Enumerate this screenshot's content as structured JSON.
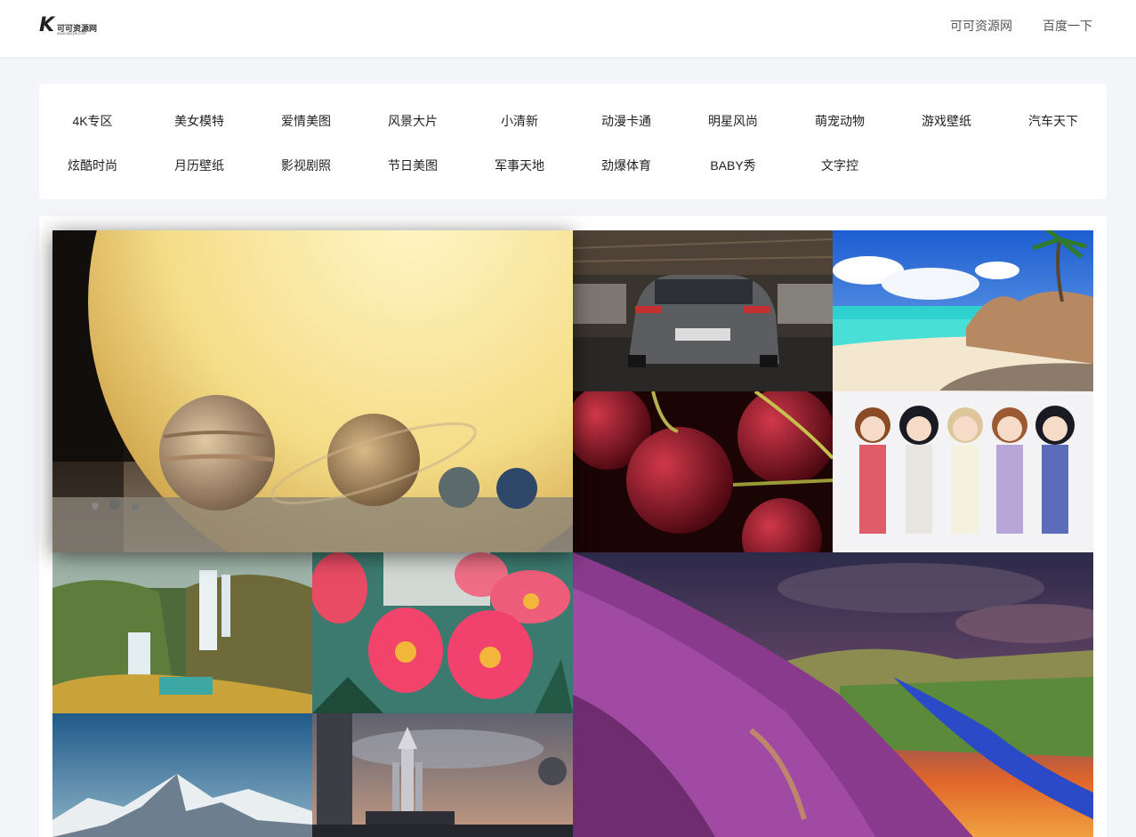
{
  "header": {
    "logo_letter": "K",
    "logo_text": "可可资源网",
    "logo_url": "www.kkzyw.com",
    "nav": [
      "可可资源网",
      "百度一下"
    ]
  },
  "categories": [
    "4K专区",
    "美女模特",
    "爱情美图",
    "风景大片",
    "小清新",
    "动漫卡通",
    "明星风尚",
    "萌宠动物",
    "游戏壁纸",
    "汽车天下",
    "炫酷时尚",
    "月历壁纸",
    "影视剧照",
    "节日美图",
    "军事天地",
    "劲爆体育",
    "BABY秀",
    "文字控"
  ],
  "gallery": [
    {
      "name": "planets-wallpaper"
    },
    {
      "name": "sports-car-wallpaper"
    },
    {
      "name": "beach-wallpaper"
    },
    {
      "name": "cherries-wallpaper"
    },
    {
      "name": "anime-girls-wallpaper"
    },
    {
      "name": "waterfall-wallpaper"
    },
    {
      "name": "camellia-flowers-wallpaper"
    },
    {
      "name": "heather-hillside-wallpaper"
    },
    {
      "name": "snowy-mountains-wallpaper"
    },
    {
      "name": "space-shuttle-wallpaper"
    }
  ],
  "colors": {
    "page_bg": "#f4f5f9",
    "panel_bg": "#ffffff",
    "text": "#222222",
    "nav_text": "#555555"
  }
}
